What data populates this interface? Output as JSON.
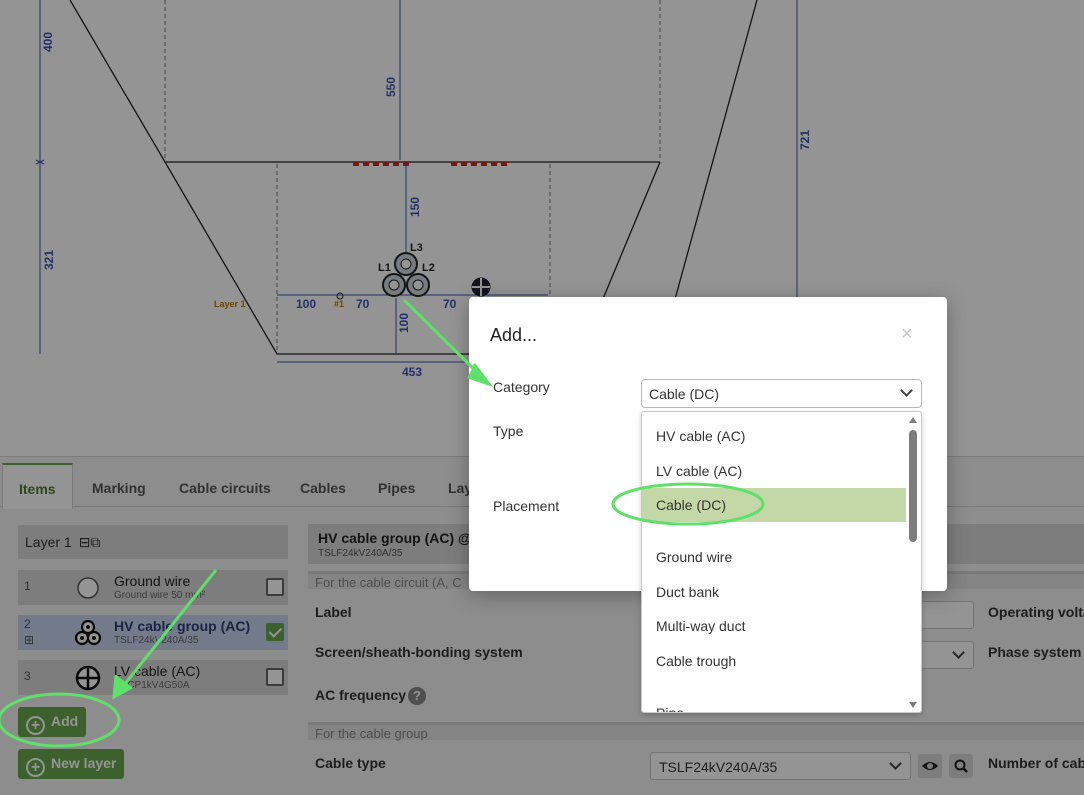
{
  "drawing": {
    "dimensions": [
      "400",
      "550",
      "721",
      "321",
      "150",
      "100",
      "70",
      "70",
      "100",
      "453"
    ],
    "phase_labels": [
      "L3",
      "L1",
      "L2"
    ],
    "marker": "#1",
    "layer_tag": "Layer 1"
  },
  "tabs": [
    "Items",
    "Marking",
    "Cable circuits",
    "Cables",
    "Pipes",
    "Lay"
  ],
  "layer": {
    "name": "Layer 1",
    "icons": "⊟⧉"
  },
  "items": [
    {
      "num": "1",
      "name": "Ground wire",
      "sub": "Ground wire 50 mm²",
      "checked": false
    },
    {
      "num": "2",
      "plus": "⊞",
      "name": "HV cable group (AC)",
      "sub": "TSLF24kV240A/35",
      "checked": true
    },
    {
      "num": "3",
      "name": "LV cable (AC)",
      "sub": "AXCP1kV4G50A",
      "checked": false
    }
  ],
  "buttons": {
    "add": "Add",
    "new_layer": "New layer"
  },
  "properties": {
    "title": "HV cable group (AC) @ l",
    "subtitle": "TSLF24kV240A/35",
    "section_circuit": "For the cable circuit (A, C",
    "label": "Label",
    "screen": "Screen/sheath-bonding system",
    "ac_frequency": "AC frequency",
    "help": "?",
    "operating_voltage": "Operating volta",
    "phase_system": "Phase system",
    "section_group": "For the cable group",
    "cable_type_label": "Cable type",
    "cable_type_value": "TSLF24kV240A/35",
    "number_of_cables": "Number of cabl"
  },
  "dialog": {
    "title": "Add...",
    "close": "×",
    "category_label": "Category",
    "category_value": "Cable (DC)",
    "type_label": "Type",
    "placement_label": "Placement"
  },
  "dropdown": {
    "options": [
      "HV cable (AC)",
      "LV cable (AC)",
      "Cable (DC)",
      "Ground wire",
      "Duct bank",
      "Multi-way duct",
      "Cable trough",
      "Pipe"
    ],
    "selected": "Cable (DC)"
  },
  "colors": {
    "accent_green": "#6aa84f",
    "highlight_green": "#c3d8a6",
    "annotation_green": "#5ee06a",
    "dimension_blue": "#3a56b5",
    "marking_red": "#cc2a1f"
  }
}
